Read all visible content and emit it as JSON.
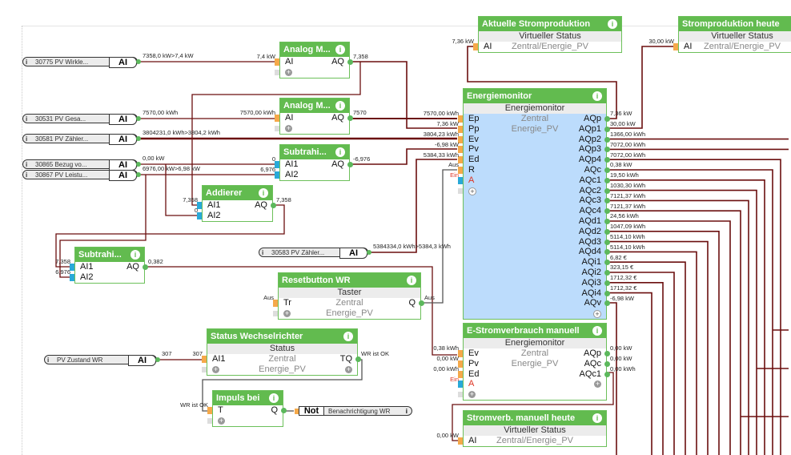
{
  "colors": {
    "wire": "#6b0f0f",
    "wire_control": "#555555",
    "header": "#62bb4f",
    "port_analog": "#f5a94a",
    "port_digital": "#29a9d8",
    "port_out": "#5cb85c",
    "monitor_body": "#bcdcfc"
  },
  "tags": [
    {
      "id": "t30775",
      "icon": "info-icon",
      "label": "30775  PV  Wirkle...",
      "kind": "AI",
      "out_val": "7358,0 kW>7,4 kW"
    },
    {
      "id": "t30531",
      "icon": "info-icon",
      "label": "30531  PV  Gesa...",
      "kind": "AI",
      "out_val": "7570,00 kWh"
    },
    {
      "id": "t30581",
      "icon": "info-icon",
      "label": "30581  PV  Zähler...",
      "kind": "AI",
      "out_val": "3804231,0 kWh>3804,2 kWh"
    },
    {
      "id": "t30865",
      "icon": "info-icon",
      "label": "30865  Bezug  vo...",
      "kind": "AI",
      "out_val": "0,00 kW"
    },
    {
      "id": "t30867",
      "icon": "info-icon",
      "label": "30867  PV  Leistu...",
      "kind": "AI",
      "out_val": "6976,00 kW>6,98 kW"
    },
    {
      "id": "t30583",
      "icon": "info-icon",
      "label": "30583  PV  Zähler...",
      "kind": "AI",
      "out_val": "5384334,0 kWh>5384,3 kWh"
    },
    {
      "id": "tzustand",
      "icon": "info-icon",
      "label": "PV Zustand WR",
      "kind": "AI",
      "out_val": "307"
    }
  ],
  "not_tag": {
    "kind": "Not",
    "label": "Benachrichtigung WR",
    "icon": "info-icon"
  },
  "blocks": [
    {
      "id": "analog1",
      "title": "Analog M...",
      "rows": [
        {
          "in": "AI",
          "in_val": "7,4 kW",
          "out": "AQ",
          "out_val": "7,358"
        },
        {
          "plus_in": true
        }
      ]
    },
    {
      "id": "analog2",
      "title": "Analog M...",
      "rows": [
        {
          "in": "AI",
          "in_val": "7570,00 kWh",
          "out": "AQ",
          "out_val": "7570"
        },
        {
          "plus_in": true
        }
      ]
    },
    {
      "id": "sub1",
      "title": "Subtrahi...",
      "rows": [
        {
          "in": "AI1",
          "in_val": "0",
          "pin": "digital",
          "out": "AQ",
          "out_val": "-6,976"
        },
        {
          "in": "AI2",
          "in_val": "6,976",
          "pin": "digital"
        }
      ]
    },
    {
      "id": "add",
      "title": "Addierer",
      "rows": [
        {
          "in": "AI1",
          "in_val": "7,358",
          "pin": "digital",
          "out": "AQ",
          "out_val": "7,358"
        },
        {
          "in": "AI2",
          "in_val": "0",
          "pin": "digital"
        }
      ]
    },
    {
      "id": "sub2",
      "title": "Subtrahi...",
      "rows": [
        {
          "in": "AI1",
          "in_val": "7,358",
          "pin": "digital",
          "out": "AQ",
          "out_val": "0,382"
        },
        {
          "in": "AI2",
          "in_val": "6,976",
          "pin": "digital"
        }
      ]
    },
    {
      "id": "reset",
      "title": "Resetbutton WR",
      "subtitle": "Taster",
      "rows": [
        {
          "in": "Tr",
          "in_val": "Aus",
          "center": "Zentral",
          "out": "Q",
          "out_val": "Aus"
        },
        {
          "plus_in": true,
          "center": "Energie_PV"
        }
      ]
    },
    {
      "id": "status",
      "title": "Status Wechselrichter",
      "subtitle": "Status",
      "rows": [
        {
          "in": "AI1",
          "in_val": "307",
          "center": "Zentral",
          "out": "TQ",
          "out_val": "WR ist OK"
        },
        {
          "plus_in": true,
          "center": "Energie_PV",
          "plus_out": true
        }
      ]
    },
    {
      "id": "impuls",
      "title": "Impuls bei",
      "rows": [
        {
          "in": "T",
          "in_val": "WR ist OK",
          "out": "Q"
        },
        {
          "plus_in": true
        }
      ]
    },
    {
      "id": "aktuelle",
      "title": "Aktuelle Stromproduktion",
      "subtitle": "Virtueller Status",
      "rows": [
        {
          "in": "AI",
          "in_val": "7,36 kW",
          "center": "Zentral/Energie_PV"
        }
      ]
    },
    {
      "id": "heute",
      "title": "Stromproduktion heute",
      "subtitle": "Virtueller Status",
      "rows": [
        {
          "in": "AI",
          "in_val": "30,00 kW",
          "center": "Zentral/Energie_PV"
        }
      ]
    },
    {
      "id": "em",
      "title": "Energiemonitor",
      "subtitle": "Energiemonitor",
      "body": "monitor",
      "rows": [
        {
          "in": "Ep",
          "in_val": "7570,00 kWh",
          "center": "Zentral",
          "out": "AQp",
          "out_val": "7,36 kW"
        },
        {
          "in": "Pp",
          "in_val": "7,36 kW",
          "center": "Energie_PV",
          "out": "AQp1",
          "out_val": "30,00 kW"
        },
        {
          "in": "Ev",
          "in_val": "3804,23 kWh",
          "out": "AQp2",
          "out_val": "1366,00 kWh"
        },
        {
          "in": "Pv",
          "in_val": "-6,98 kW",
          "out": "AQp3",
          "out_val": "7072,00 kWh"
        },
        {
          "in": "Ed",
          "in_val": "5384,33 kWh",
          "out": "AQp4",
          "out_val": "7072,00 kWh"
        },
        {
          "in": "R",
          "in_val": "Aus",
          "out": "AQc",
          "out_val": "0,38 kW"
        },
        {
          "in": "A",
          "in_val": "Ein",
          "pin": "digital",
          "red": true,
          "out": "AQc1",
          "out_val": "19,50 kWh"
        },
        {
          "plus_in": true,
          "plus_white": true,
          "out": "AQc2",
          "out_val": "1030,30 kWh"
        },
        {
          "out": "AQc3",
          "out_val": "7121,37 kWh"
        },
        {
          "out": "AQc4",
          "out_val": "7121,37 kWh"
        },
        {
          "out": "AQd1",
          "out_val": "24,56 kWh"
        },
        {
          "out": "AQd2",
          "out_val": "1047,09 kWh"
        },
        {
          "out": "AQd3",
          "out_val": "5114,10 kWh"
        },
        {
          "out": "AQd4",
          "out_val": "5114,10 kWh"
        },
        {
          "out": "AQi1",
          "out_val": "6,82 €"
        },
        {
          "out": "AQi2",
          "out_val": "323,15 €"
        },
        {
          "out": "AQi3",
          "out_val": "1712,32 €"
        },
        {
          "out": "AQi4",
          "out_val": "1712,32 €"
        },
        {
          "out": "AQv",
          "out_val": "-6,98 kW"
        },
        {
          "plus_out": true,
          "plus_white": true
        }
      ]
    },
    {
      "id": "estrom",
      "title": "E-Stromverbrauch manuell",
      "subtitle": "Energiemonitor",
      "rows": [
        {
          "in": "Ev",
          "in_val": "0,38 kWh",
          "center": "Zentral",
          "out": "AQp",
          "out_val": "0,00 kW"
        },
        {
          "in": "Pv",
          "in_val": "0,00 kW",
          "center": "Energie_PV",
          "out": "AQc",
          "out_val": "0,00 kW"
        },
        {
          "in": "Ed",
          "in_val": "0,00 kWh",
          "out": "AQc1",
          "out_val": "0,00 kWh"
        },
        {
          "in": "A",
          "in_val": "Ein",
          "pin": "digital",
          "red": true,
          "plus_out": true
        },
        {
          "plus_in": true
        }
      ]
    },
    {
      "id": "smheute",
      "title": "Stromverb. manuell heute",
      "subtitle": "Virtueller Status",
      "rows": [
        {
          "in": "AI",
          "in_val": "0,00 kW",
          "center": "Zentral/Energie_PV"
        }
      ]
    }
  ]
}
